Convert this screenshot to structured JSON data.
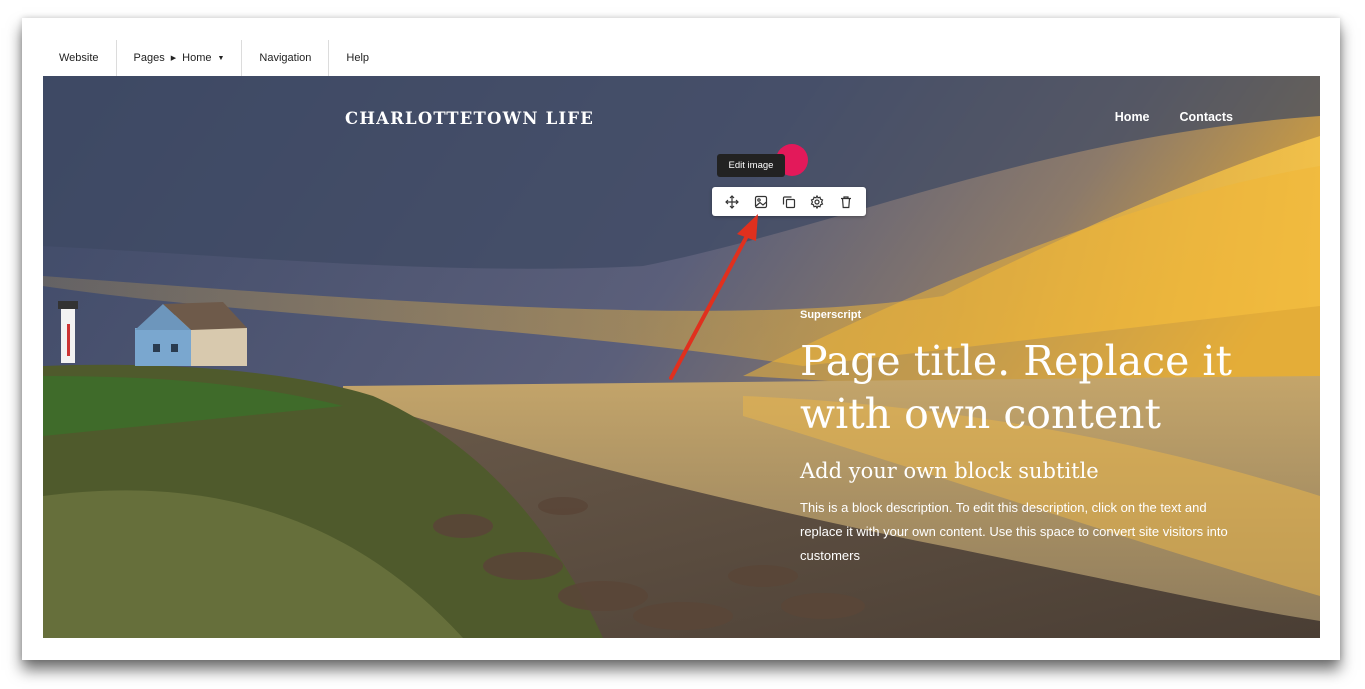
{
  "editor_menu": {
    "website": "Website",
    "pages": "Pages",
    "current_page": "Home",
    "navigation": "Navigation",
    "help": "Help"
  },
  "site": {
    "brand": "CHARLOTTETOWN LIFE",
    "nav": [
      "Home",
      "Contacts"
    ]
  },
  "block_toolbar": {
    "tooltip": "Edit image",
    "icons": [
      "move-icon",
      "image-icon",
      "duplicate-icon",
      "settings-icon",
      "trash-icon"
    ]
  },
  "hero": {
    "superscript": "Superscript",
    "title": "Page title. Replace it with own content",
    "subtitle": "Add your own block subtitle",
    "description": "This is a block description. To edit this description, click on the text and replace it with your own content. Use this space to convert site visitors into customers"
  },
  "colors": {
    "highlight": "#e3195a",
    "annotation_arrow": "#e0301e",
    "tooltip_bg": "#222222"
  }
}
